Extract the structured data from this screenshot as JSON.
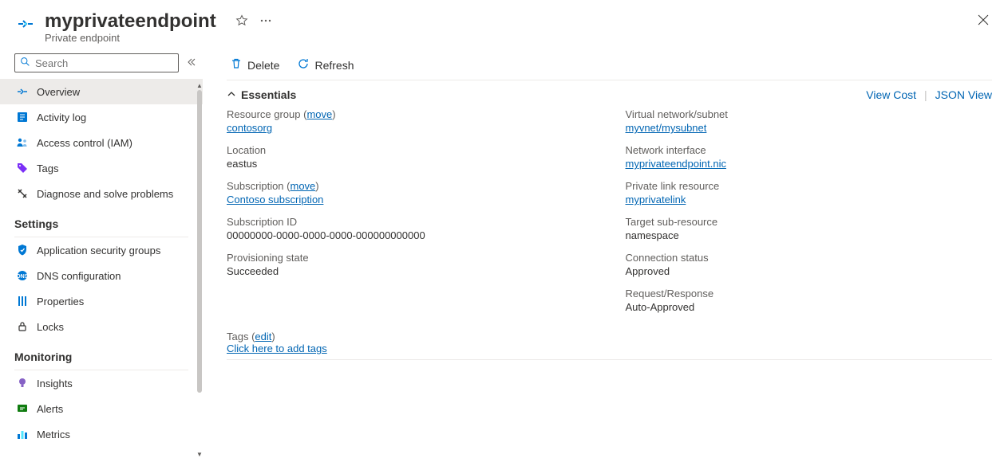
{
  "header": {
    "title": "myprivateendpoint",
    "subtitle": "Private endpoint"
  },
  "search": {
    "placeholder": "Search"
  },
  "nav": {
    "overview": "Overview",
    "activity_log": "Activity log",
    "access_control": "Access control (IAM)",
    "tags": "Tags",
    "diagnose": "Diagnose and solve problems",
    "section_settings": "Settings",
    "app_sec_groups": "Application security groups",
    "dns_config": "DNS configuration",
    "properties": "Properties",
    "locks": "Locks",
    "section_monitoring": "Monitoring",
    "insights": "Insights",
    "alerts": "Alerts",
    "metrics": "Metrics"
  },
  "toolbar": {
    "delete": "Delete",
    "refresh": "Refresh"
  },
  "essentials": {
    "title": "Essentials",
    "view_cost": "View Cost",
    "json_view": "JSON View",
    "left": {
      "resource_group_label": "Resource group",
      "move1": "move",
      "resource_group_value": "contosorg",
      "location_label": "Location",
      "location_value": "eastus",
      "subscription_label": "Subscription",
      "move2": "move",
      "subscription_value": "Contoso subscription",
      "subscription_id_label": "Subscription ID",
      "subscription_id_value": "00000000-0000-0000-0000-000000000000",
      "provisioning_label": "Provisioning state",
      "provisioning_value": "Succeeded"
    },
    "right": {
      "vnet_label": "Virtual network/subnet",
      "vnet_value": "myvnet/mysubnet",
      "nic_label": "Network interface",
      "nic_value": "myprivateendpoint.nic",
      "plr_label": "Private link resource",
      "plr_value": "myprivatelink",
      "target_label": "Target sub-resource",
      "target_value": "namespace",
      "conn_label": "Connection status",
      "conn_value": "Approved",
      "req_label": "Request/Response",
      "req_value": "Auto-Approved"
    },
    "tags_label": "Tags",
    "tags_edit": "edit",
    "tags_add": "Click here to add tags"
  }
}
